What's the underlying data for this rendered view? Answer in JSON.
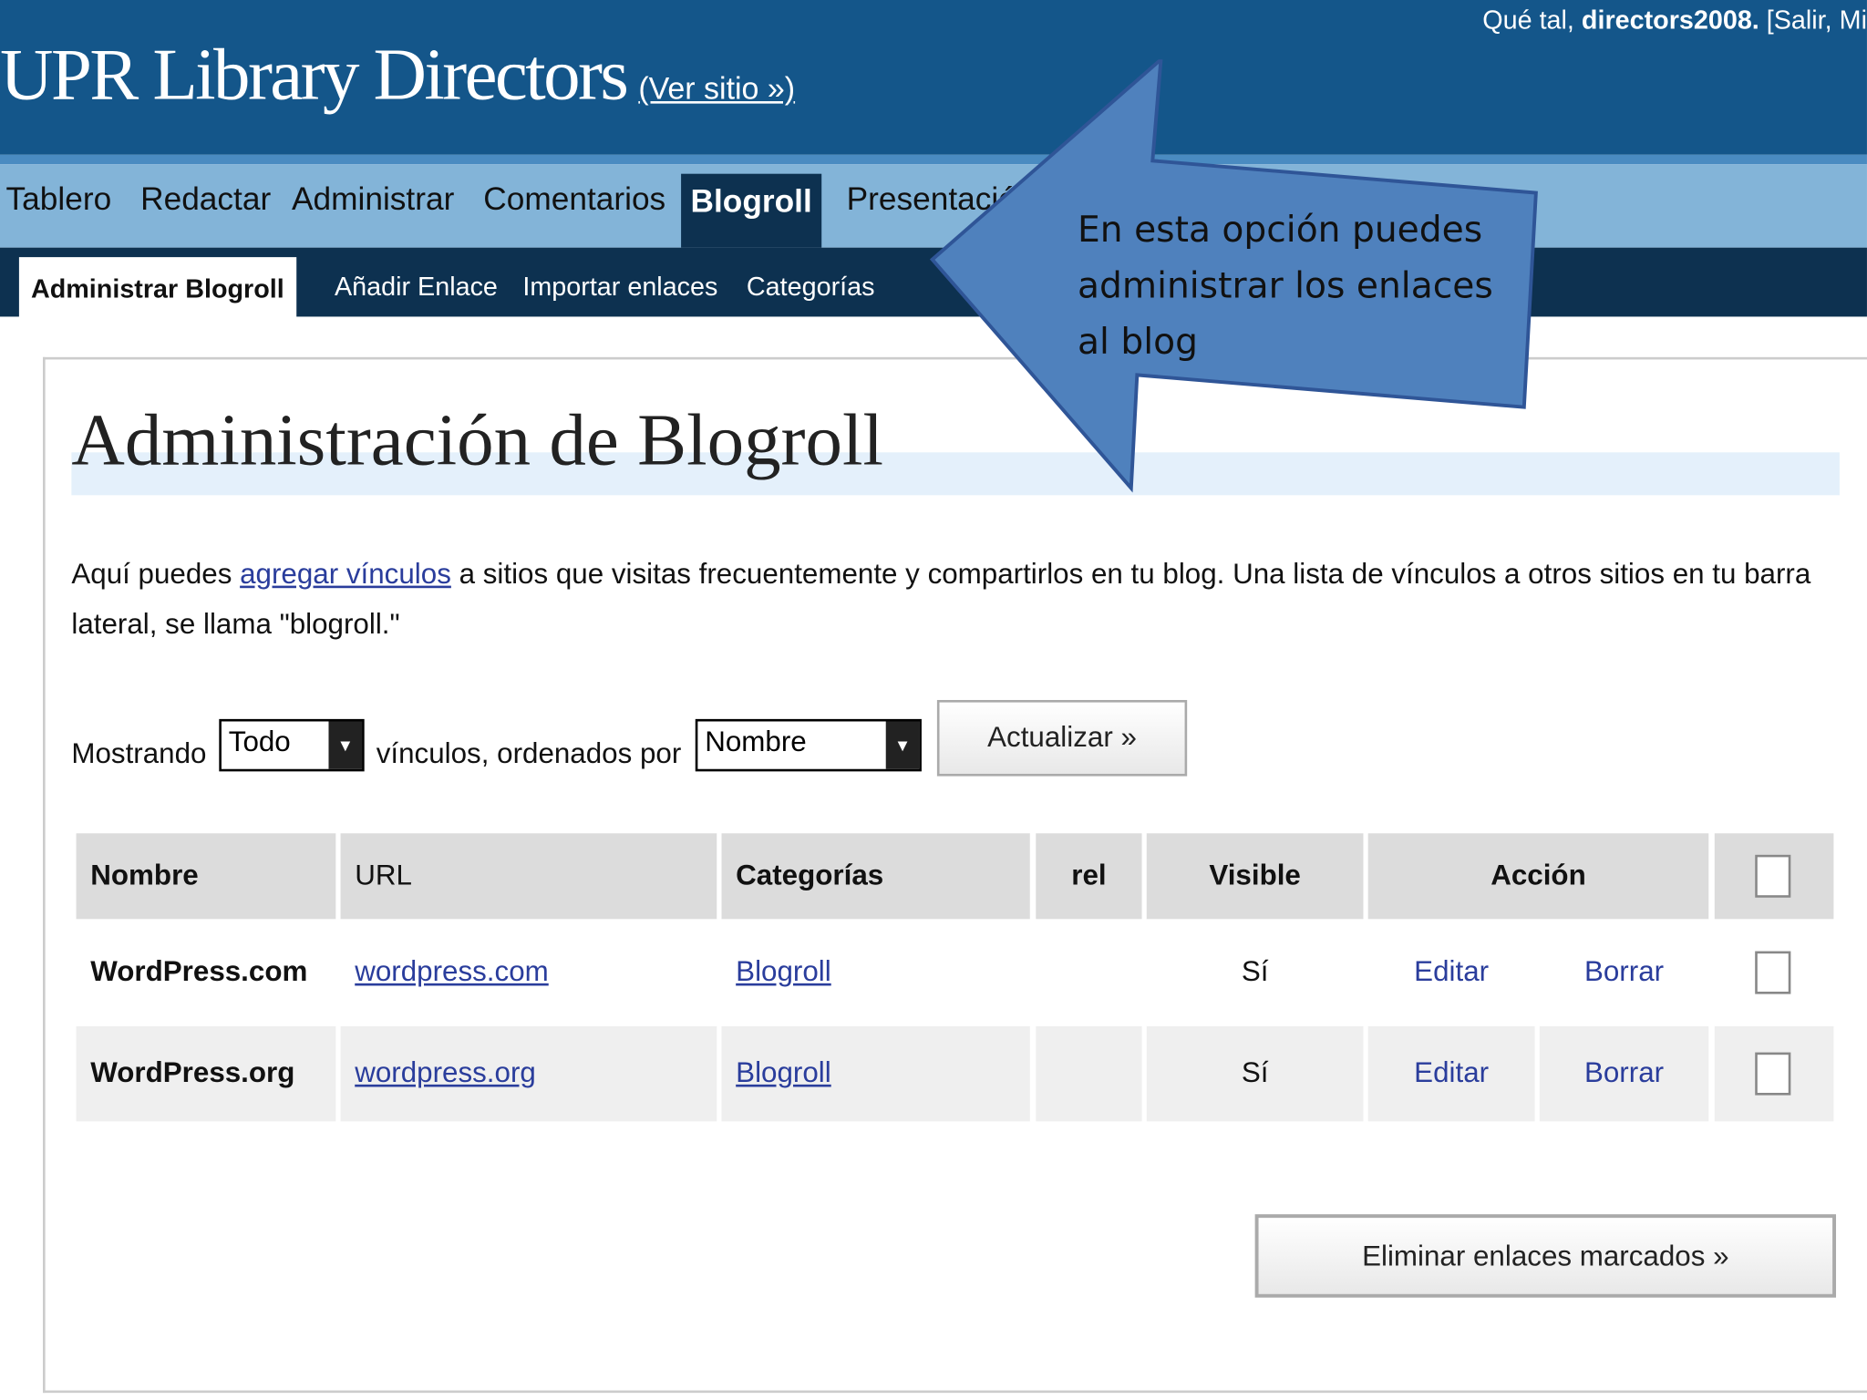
{
  "header": {
    "blog_name": "UPR Library Directors",
    "view_site": "(Ver sitio »)",
    "greeting_prefix": "Qué tal,",
    "username": "directors2008.",
    "greeting_links": "[Salir, Mi"
  },
  "nav": {
    "items": [
      {
        "label": "Tablero"
      },
      {
        "label": "Redactar"
      },
      {
        "label": "Administrar"
      },
      {
        "label": "Comentarios"
      },
      {
        "label": "Blogroll"
      },
      {
        "label": "Presentación"
      }
    ],
    "active": "Blogroll"
  },
  "subnav": {
    "items": [
      {
        "label": "Administrar Blogroll"
      },
      {
        "label": "Añadir Enlace"
      },
      {
        "label": "Importar enlaces"
      },
      {
        "label": "Categorías"
      }
    ],
    "active": "Administrar Blogroll"
  },
  "main": {
    "title": "Administración de Blogroll",
    "intro_before": "Aquí puedes ",
    "intro_link": "agregar vínculos",
    "intro_after": " a sitios que visitas frecuentemente y compartirlos en tu blog. Una lista de vínculos a otros sitios en tu barra lateral, se llama \"blogroll.\"",
    "filter": {
      "showing_label": "Mostrando",
      "show_value": "Todo",
      "middle_label": "vínculos, ordenados por",
      "order_value": "Nombre",
      "update_button": "Actualizar »"
    },
    "table": {
      "headers": [
        "Nombre",
        "URL",
        "Categorías",
        "rel",
        "Visible",
        "Acción"
      ],
      "rows": [
        {
          "name": "WordPress.com",
          "url": "wordpress.com",
          "category": "Blogroll",
          "rel": "",
          "visible": "Sí",
          "edit": "Editar",
          "delete": "Borrar"
        },
        {
          "name": "WordPress.org",
          "url": "wordpress.org",
          "category": "Blogroll",
          "rel": "",
          "visible": "Sí",
          "edit": "Editar",
          "delete": "Borrar"
        }
      ]
    },
    "delete_button": "Eliminar enlaces marcados »"
  },
  "callout": {
    "text": "En esta opción puedes administrar los enlaces al blog",
    "color": "#4f81bd"
  },
  "colors": {
    "header": "#14568a",
    "nav": "#83b4d8",
    "subnav": "#0d3150"
  }
}
